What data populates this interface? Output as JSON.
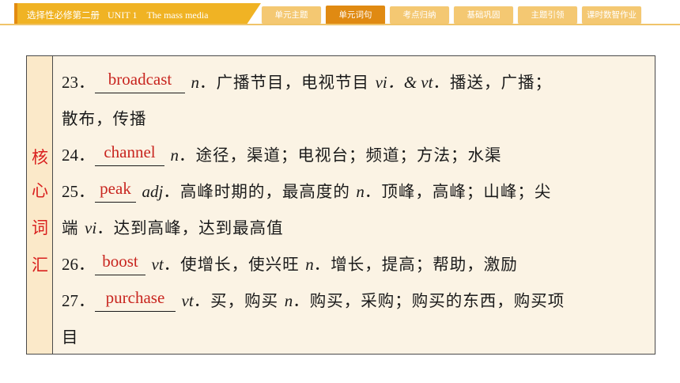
{
  "header": {
    "book_title": "选择性必修第二册",
    "unit_title": "UNIT 1　The mass media",
    "nav": [
      {
        "label": "单元主题",
        "active": false
      },
      {
        "label": "单元词句",
        "active": true
      },
      {
        "label": "考点归纳",
        "active": false
      },
      {
        "label": "基础巩固",
        "active": false
      },
      {
        "label": "主题引领",
        "active": false
      },
      {
        "label": "课时数智作业",
        "active": false
      }
    ]
  },
  "sidebar": {
    "chars": [
      "核",
      "心",
      "词",
      "汇"
    ]
  },
  "entries": [
    {
      "num": "23．",
      "word": "broadcast",
      "rest1_pos": "n",
      "rest1": "．广播节目，电视节目",
      "rest2_pos": "vi．& vt",
      "rest2": "．播送，广播；",
      "cont": "散布，传播"
    },
    {
      "num": "24．",
      "word": "channel",
      "rest1_pos": "n",
      "rest1": "．途径，渠道；电视台；频道；方法；水渠"
    },
    {
      "num": "25．",
      "word": "peak",
      "rest1_pos": "adj",
      "rest1": "．高峰时期的，最高度的",
      "rest2_pos": "n",
      "rest2": "．顶峰，高峰；山峰；尖",
      "cont_pre": "端",
      "cont_pos": "vi",
      "cont": "．达到高峰，达到最高值"
    },
    {
      "num": "26．",
      "word": "boost",
      "rest1_pos": "vt",
      "rest1": "．使增长，使兴旺",
      "rest2_pos": "n",
      "rest2": "．增长，提高；帮助，激励"
    },
    {
      "num": "27．",
      "word": "purchase",
      "rest1_pos": "vt",
      "rest1": "．买，购买",
      "rest2_pos": "n",
      "rest2": "．购买，采购；购买的东西，购买项",
      "cont": "目"
    }
  ]
}
